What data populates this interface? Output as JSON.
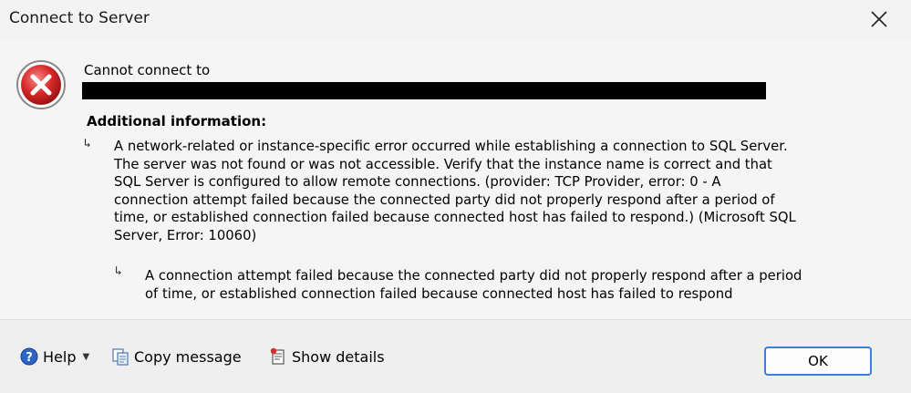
{
  "window": {
    "title": "Connect to Server",
    "close_icon": "close-icon"
  },
  "message": {
    "line1": "Cannot connect to",
    "additional_heading": "Additional information:",
    "details": [
      "A network-related or instance-specific error occurred while establishing a connection to SQL Server.\nThe server was not found or was not accessible. Verify that the instance name is correct and that\nSQL Server is configured to allow remote connections. (provider: TCP Provider, error: 0 - A\nconnection attempt failed because the connected party did not properly respond after a period of\ntime, or established connection failed because connected host has failed to respond.) (Microsoft SQL\nServer, Error: 10060)",
      "A connection attempt failed because the connected party did not properly respond after a period\nof time, or established connection failed because connected host has failed to respond"
    ]
  },
  "footer": {
    "help_label": "Help",
    "copy_label": "Copy message",
    "show_details_label": "Show details",
    "ok_label": "OK"
  },
  "colors": {
    "error_red": "#d92b2b",
    "ok_border": "#3b7fd6",
    "help_blue": "#2f64c7"
  },
  "icons": [
    "error-icon",
    "close-icon",
    "help-icon",
    "copy-icon",
    "show-details-icon",
    "chevron-down-icon",
    "arrow-indent-icon"
  ]
}
